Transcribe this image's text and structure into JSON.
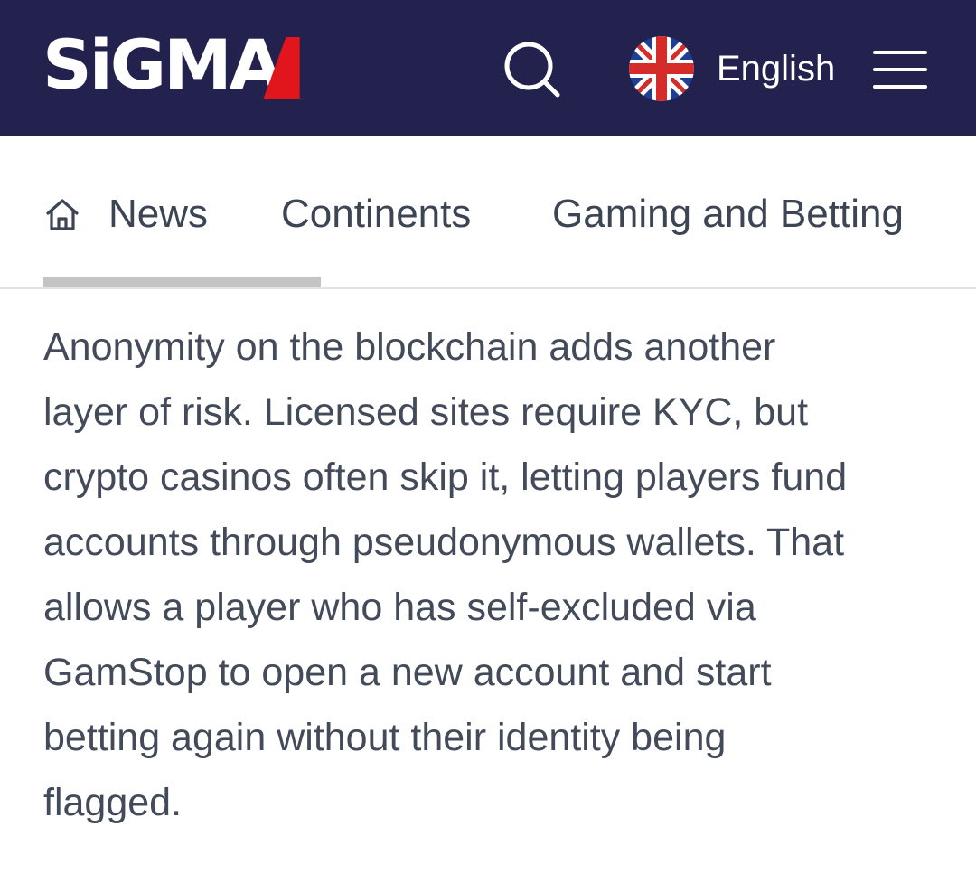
{
  "header": {
    "logo_text": "SiGMA",
    "search_icon": "search-icon",
    "language": {
      "flag_icon": "uk-flag-icon",
      "label": "English"
    },
    "menu_icon": "hamburger-menu-icon",
    "colors": {
      "background": "#23224f",
      "logo_accent": "#e1161c"
    }
  },
  "nav": {
    "home_icon": "home-icon",
    "items": [
      {
        "label": "News",
        "active": true
      },
      {
        "label": "Continents",
        "active": false
      },
      {
        "label": "Gaming and Betting",
        "active": false
      }
    ]
  },
  "article": {
    "lines": [
      "Anonymity on the blockchain adds another",
      "layer of risk. Licensed sites require KYC, but",
      "crypto casinos often skip it, letting players fund",
      "accounts through pseudonymous wallets. That",
      "allows a player who has self-excluded via",
      "GamStop to open a new account and start",
      "betting again without their identity being",
      "flagged."
    ]
  }
}
